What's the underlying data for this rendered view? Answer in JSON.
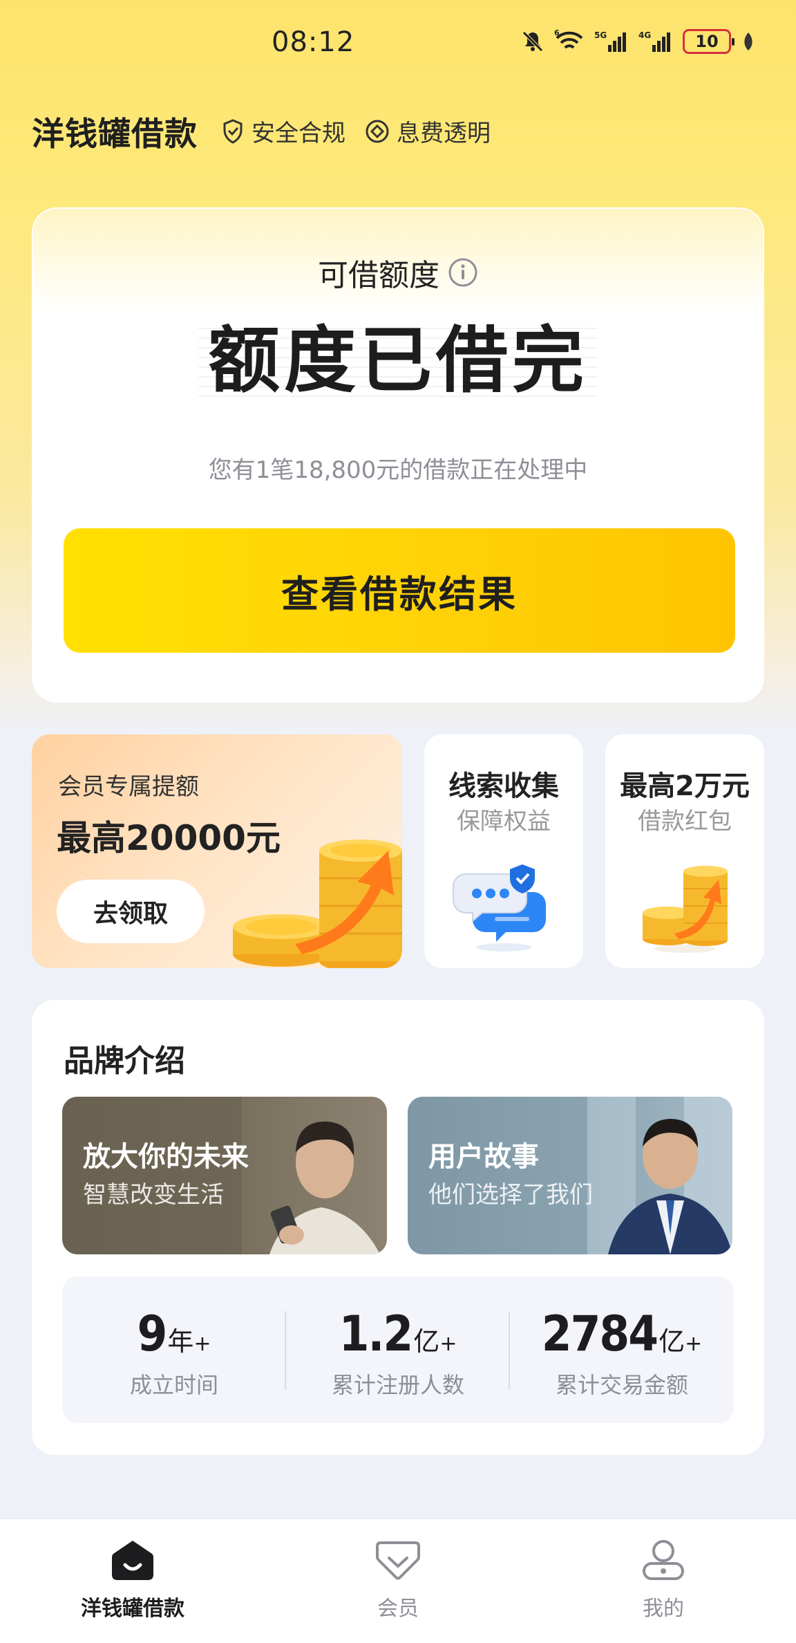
{
  "status_bar": {
    "time": "08:12",
    "battery": "10",
    "network": [
      "5G",
      "4G"
    ]
  },
  "header": {
    "title": "洋钱罐借款",
    "tags": [
      "安全合规",
      "息费透明"
    ]
  },
  "credit": {
    "label": "可借额度",
    "status": "额度已借完",
    "note": "您有1笔18,800元的借款正在处理中",
    "button": "查看借款结果"
  },
  "promo": {
    "main": {
      "subtitle": "会员专属提额",
      "amount": "最高20000元",
      "button": "去领取"
    },
    "cards": [
      {
        "title": "线索收集",
        "subtitle": "保障权益"
      },
      {
        "title": "最高2万元",
        "subtitle": "借款红包"
      }
    ]
  },
  "brand": {
    "title": "品牌介绍",
    "stories": [
      {
        "title": "放大你的未来",
        "subtitle": "智慧改变生活"
      },
      {
        "title": "用户故事",
        "subtitle": "他们选择了我们"
      }
    ],
    "stats": [
      {
        "value": "9",
        "unit": "年",
        "plus": "+",
        "label": "成立时间"
      },
      {
        "value": "1.2",
        "unit": "亿",
        "plus": "+",
        "label": "累计注册人数"
      },
      {
        "value": "2784",
        "unit": "亿",
        "plus": "+",
        "label": "累计交易金额"
      }
    ]
  },
  "nav": {
    "items": [
      {
        "label": "洋钱罐借款",
        "icon": "home-icon",
        "active": true
      },
      {
        "label": "会员",
        "icon": "member-icon",
        "active": false
      },
      {
        "label": "我的",
        "icon": "profile-icon",
        "active": false
      }
    ]
  },
  "colors": {
    "accent": "#ffd208",
    "text": "#1d1d1f",
    "muted": "#8d8f96"
  }
}
